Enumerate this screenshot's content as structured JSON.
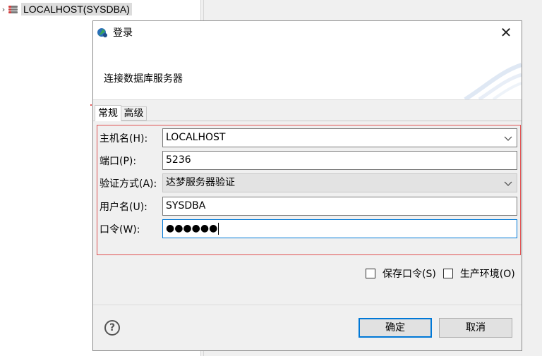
{
  "background": {
    "tree_item_label": "LOCALHOST(SYSDBA)"
  },
  "dialog": {
    "title": "登录",
    "banner_text": "连接数据库服务器",
    "tabs": [
      {
        "label": "常规",
        "active": true
      },
      {
        "label": "高级",
        "active": false
      }
    ],
    "fields": {
      "host": {
        "label": "主机名(H):",
        "value": "LOCALHOST"
      },
      "port": {
        "label": "端口(P):",
        "value": "5236"
      },
      "auth": {
        "label": "验证方式(A):",
        "value": "达梦服务器验证"
      },
      "user": {
        "label": "用户名(U):",
        "value": "SYSDBA"
      },
      "password": {
        "label": "口令(W):",
        "value": "●●●●●●"
      }
    },
    "options": {
      "save_password": "保存口令(S)",
      "production_env": "生产环境(O)"
    },
    "buttons": {
      "ok": "确定",
      "cancel": "取消"
    },
    "help_glyph": "?",
    "close_glyph": "✕"
  },
  "colors": {
    "accent": "#0078d7",
    "error_border": "#e05050"
  }
}
